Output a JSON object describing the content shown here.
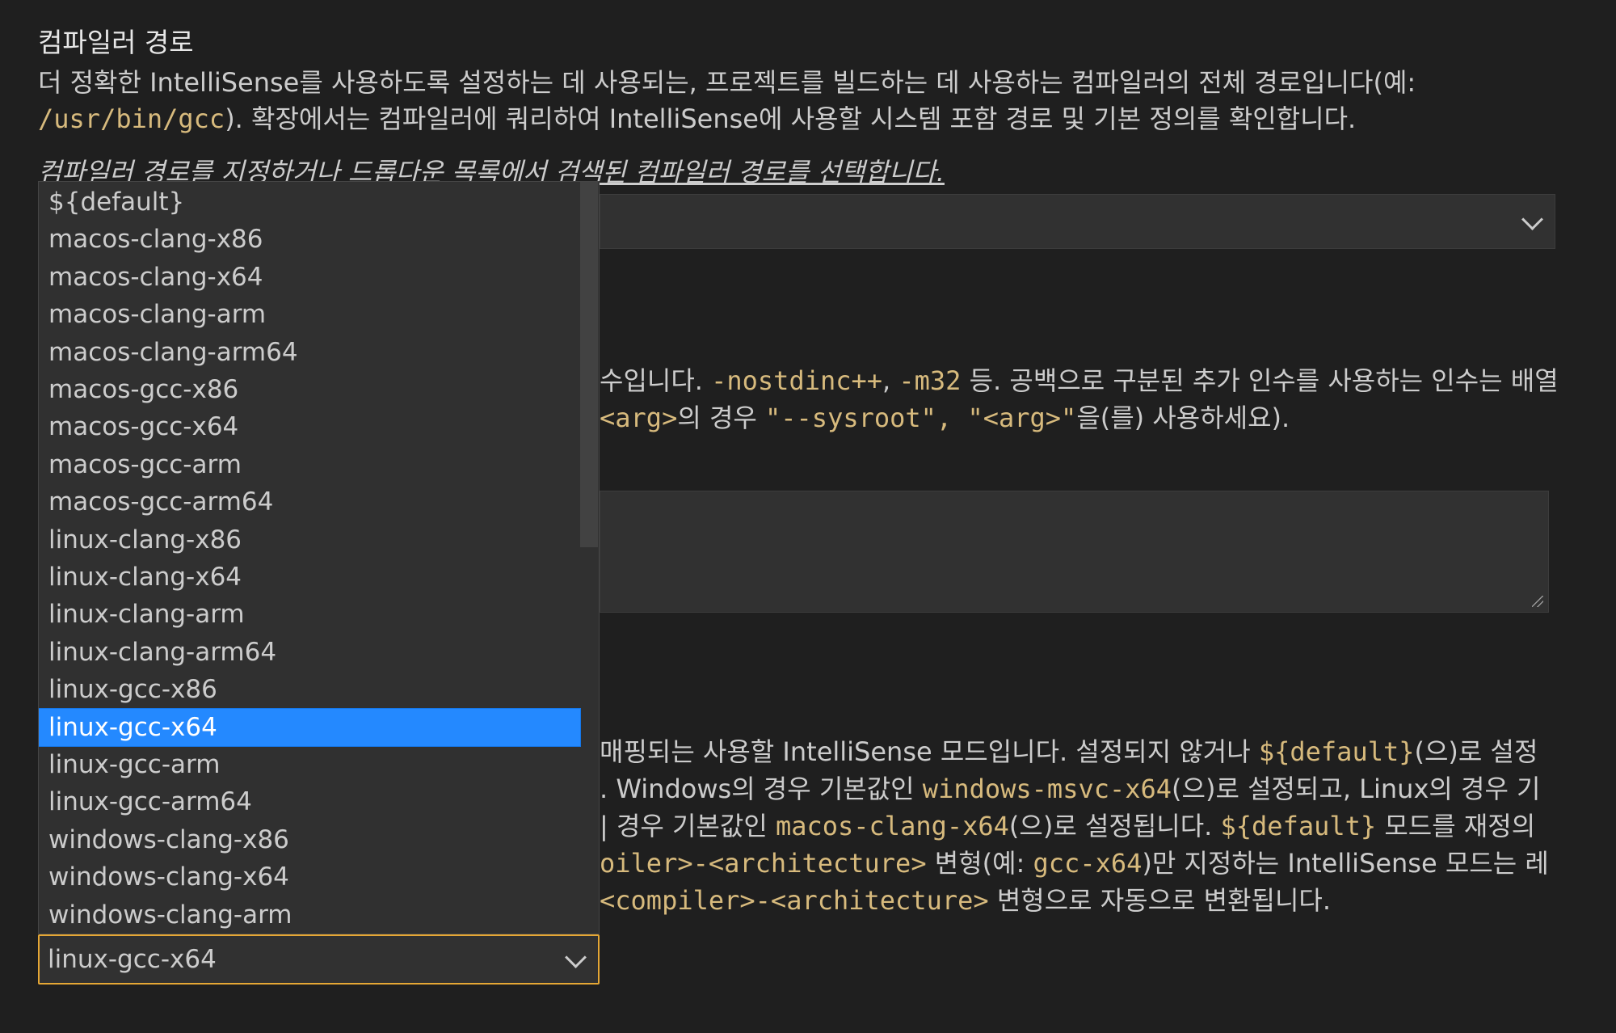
{
  "compiler_path": {
    "title": "컴파일러 경로",
    "desc_l1": "더 정확한 IntelliSense를 사용하도록 설정하는 데 사용되는, 프로젝트를 빌드하는 데 사용하는 컴파일러의 전체 경로입니다(예:",
    "desc_code": "/usr/bin/gcc",
    "desc_l2": "). 확장에서는 컴파일러에 쿼리하여 IntelliSense에 사용할 시스템 포함 경로 및 기본 정의를 확인합니다.",
    "hint": "컴파일러 경로를 지정하거나 드롭다운 목록에서 검색된 컴파일러 경로를 선택합니다."
  },
  "compiler_args": {
    "l1_a": "수입니다. ",
    "l1_c1": "-nostdinc++",
    "l1_b": ", ",
    "l1_c2": "-m32",
    "l1_c": " 등. 공백으로 구분된 추가 인수를 사용하는 인수는 배열",
    "l2_c1": "<arg>",
    "l2_a": "의 경우 ",
    "l2_c2": "\"--sysroot\", \"<arg>\"",
    "l2_b": "을(를) 사용하세요)."
  },
  "intellisense_mode": {
    "l1_a": " 매핑되는 사용할 IntelliSense 모드입니다. 설정되지 않거나 ",
    "l1_c1": "${default}",
    "l1_b": "(으)로 설정",
    "l2_a": ". Windows의 경우 기본값인 ",
    "l2_c1": "windows-msvc-x64",
    "l2_b": "(으)로 설정되고, Linux의 경우 기",
    "l3_a": "| 경우 기본값인 ",
    "l3_c1": "macos-clang-x64",
    "l3_b": "(으)로 설정됩니다. ",
    "l3_c2": "${default}",
    "l3_c": " 모드를 재정의",
    "l4_c1": "oiler>-<architecture>",
    "l4_a": " 변형(예: ",
    "l4_c2": "gcc-x64",
    "l4_b": ")만 지정하는 IntelliSense 모드는 레",
    "l5_c1": "<compiler>-<architecture>",
    "l5_a": " 변형으로 자동으로 변환됩니다.",
    "selected_value": "linux-gcc-x64",
    "options": [
      "${default}",
      "macos-clang-x86",
      "macos-clang-x64",
      "macos-clang-arm",
      "macos-clang-arm64",
      "macos-gcc-x86",
      "macos-gcc-x64",
      "macos-gcc-arm",
      "macos-gcc-arm64",
      "linux-clang-x86",
      "linux-clang-x64",
      "linux-clang-arm",
      "linux-clang-arm64",
      "linux-gcc-x86",
      "linux-gcc-x64",
      "linux-gcc-arm",
      "linux-gcc-arm64",
      "windows-clang-x86",
      "windows-clang-x64",
      "windows-clang-arm"
    ],
    "selected_index": 14
  },
  "colors": {
    "background": "#1f1f1f",
    "code": "#d7ba7d",
    "selection": "#2489ff",
    "focus_border": "#e5a735"
  }
}
